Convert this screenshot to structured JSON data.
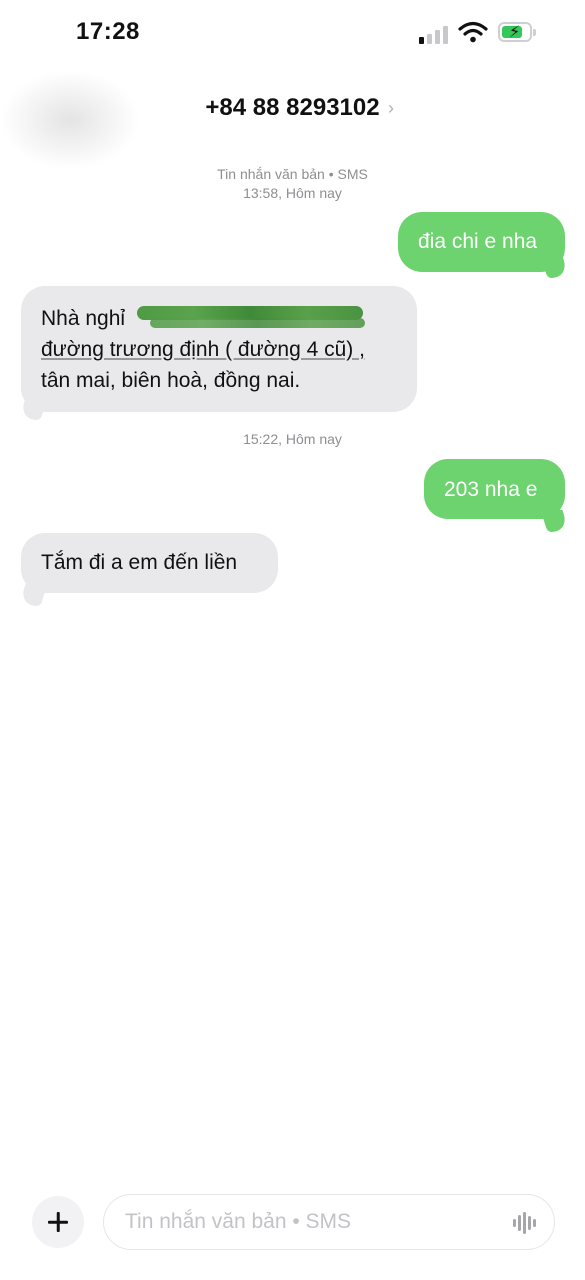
{
  "status_bar": {
    "time": "17:28"
  },
  "header": {
    "contact": "+84 88 8293102",
    "chevron_icon": "chevron-right-icon"
  },
  "conversation": {
    "meta_service": "Tin nhắn văn bản • SMS",
    "timestamp_1": "13:58, Hôm nay",
    "timestamp_2": "15:22, Hôm nay",
    "messages": [
      {
        "direction": "outgoing",
        "text": "đia chi e nha"
      },
      {
        "direction": "incoming",
        "lines": [
          "Nhà nghỉ",
          "đường trương định ( đường 4 cũ) ,",
          "tân mai, biên hoà, đồng nai."
        ]
      },
      {
        "direction": "outgoing",
        "text": "203 nha e"
      },
      {
        "direction": "incoming",
        "text": "Tắm đi a em đến liền"
      }
    ]
  },
  "input_bar": {
    "placeholder": "Tin nhắn văn bản • SMS",
    "add_icon": "plus-icon",
    "audio_icon": "waveform-icon"
  },
  "colors": {
    "outgoing_bubble": "#6dd36f",
    "incoming_bubble": "#e9e9eb",
    "redaction": "#4f9a45"
  }
}
